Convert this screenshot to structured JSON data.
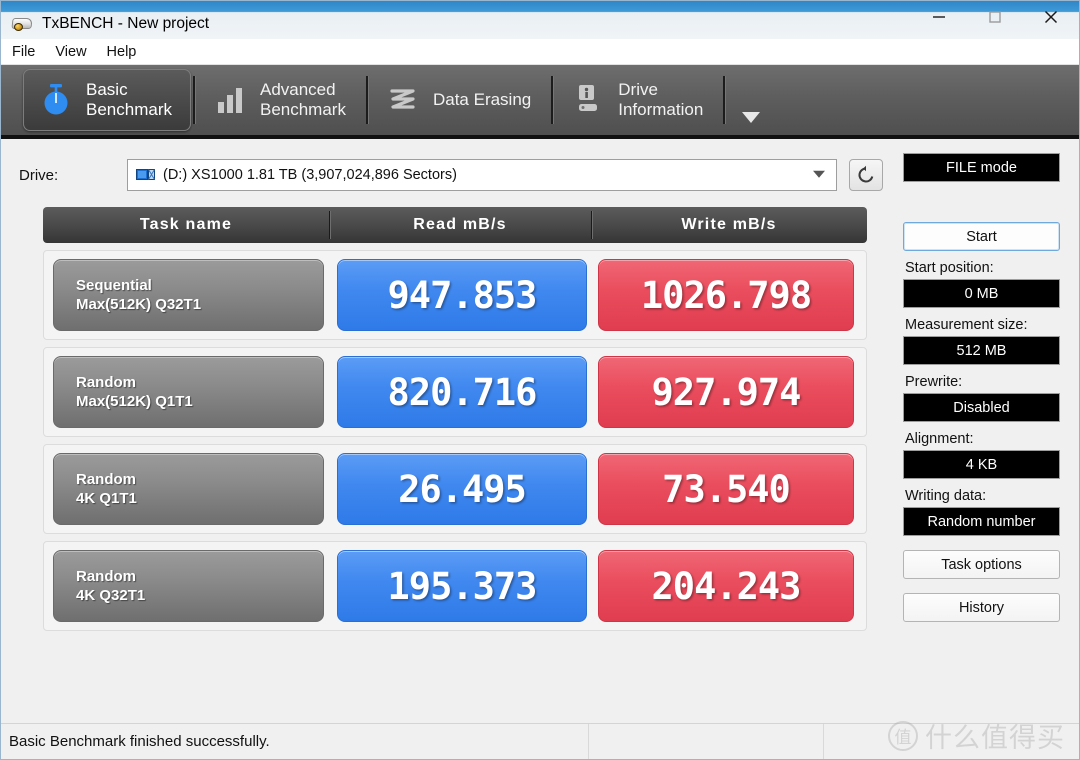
{
  "window": {
    "title": "TxBENCH - New project",
    "app_icon": "drive-device-icon",
    "controls": {
      "minimize": "minimize-icon",
      "maximize": "maximize-icon",
      "close": "close-icon"
    }
  },
  "menubar": {
    "items": [
      {
        "label": "File"
      },
      {
        "label": "View"
      },
      {
        "label": "Help"
      }
    ]
  },
  "tabs": {
    "items": [
      {
        "label": "Basic\nBenchmark",
        "icon": "stopwatch-icon",
        "active": true
      },
      {
        "label": "Advanced\nBenchmark",
        "icon": "bar-chart-icon",
        "active": false
      },
      {
        "label": "Data Erasing",
        "icon": "erase-scribble-icon",
        "active": false
      },
      {
        "label": "Drive\nInformation",
        "icon": "drive-info-icon",
        "active": false
      }
    ],
    "overflow_icon": "chevron-down-icon"
  },
  "drive": {
    "label": "Drive:",
    "icon": "removable-drive-icon",
    "selected": "(D:) XS1000  1.81 TB (3,907,024,896 Sectors)",
    "dropdown_icon": "chevron-down-icon",
    "refresh_icon": "refresh-icon"
  },
  "table": {
    "headers": {
      "name": "Task name",
      "read": "Read mB/s",
      "write": "Write mB/s"
    },
    "rows": [
      {
        "task_line1": "Sequential",
        "task_line2": "Max(512K) Q32T1",
        "read": "947.853",
        "write": "1026.798"
      },
      {
        "task_line1": "Random",
        "task_line2": "Max(512K) Q1T1",
        "read": "820.716",
        "write": "927.974"
      },
      {
        "task_line1": "Random",
        "task_line2": "4K Q1T1",
        "read": "26.495",
        "write": "73.540"
      },
      {
        "task_line1": "Random",
        "task_line2": "4K Q32T1",
        "read": "195.373",
        "write": "204.243"
      }
    ]
  },
  "sidebar": {
    "mode_button": "FILE mode",
    "start_button": "Start",
    "start_position_label": "Start position:",
    "start_position_value": "0 MB",
    "measurement_size_label": "Measurement size:",
    "measurement_size_value": "512 MB",
    "prewrite_label": "Prewrite:",
    "prewrite_value": "Disabled",
    "alignment_label": "Alignment:",
    "alignment_value": "4 KB",
    "writing_data_label": "Writing data:",
    "writing_data_value": "Random number",
    "task_options_button": "Task options",
    "history_button": "History"
  },
  "statusbar": {
    "message": "Basic Benchmark finished successfully."
  },
  "watermark": {
    "logo": "值",
    "text": "什么值得买"
  },
  "colors": {
    "read_blue": "#3c85ee",
    "write_red": "#e84a5a",
    "task_gray": "#8b8b8b",
    "header_gray": "#4a4a4a",
    "titlebar_blue": "#3f9ad8",
    "tabstrip_gray": "#5e5e5e"
  }
}
